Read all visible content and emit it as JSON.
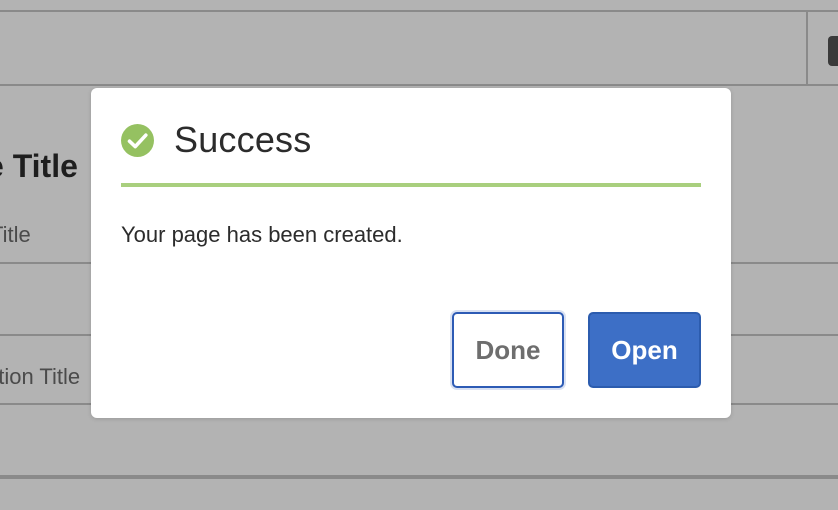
{
  "background": {
    "heading": "e Title",
    "field_label_1": "Title",
    "field_label_2": "ation Title"
  },
  "dialog": {
    "title": "Success",
    "icon": "check-circle-icon",
    "message": "Your page has been created.",
    "done_label": "Done",
    "open_label": "Open"
  },
  "colors": {
    "success_green": "#95c161",
    "rule_green": "#a9cf7e",
    "primary_blue": "#3d6fc6",
    "overlay_gray": "#b3b3b3"
  }
}
